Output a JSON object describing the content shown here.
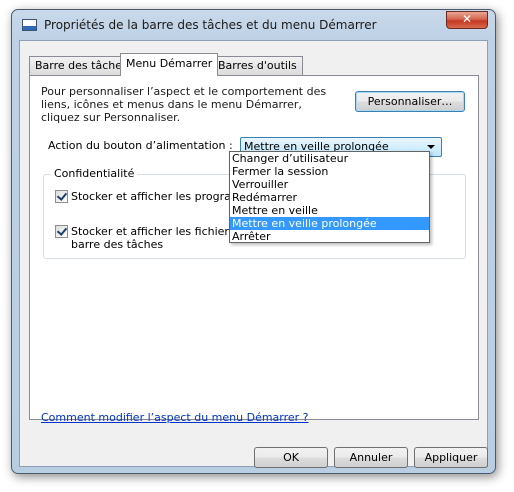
{
  "window": {
    "title": "Propriétés de la barre des tâches et du menu Démarrer",
    "close_glyph": "✕"
  },
  "tabs": [
    {
      "label": "Barre des tâches"
    },
    {
      "label": "Menu Démarrer"
    },
    {
      "label": "Barres d'outils"
    }
  ],
  "start_menu": {
    "intro": "Pour personnaliser l’aspect et le comportement des liens, icônes et menus dans le menu Démarrer, cliquez sur Personnaliser.",
    "customize_button": "Personnaliser…",
    "power_action_label": "Action du bouton d’alimentation :",
    "power_action_value": "Mettre en veille prolongée",
    "power_action_options": [
      "Changer d’utilisateur",
      "Fermer la session",
      "Verrouiller",
      "Redémarrer",
      "Mettre en veille",
      "Mettre en veille prolongée",
      "Arrêter"
    ],
    "privacy_title": "Confidentialité",
    "check_recent_programs": "Stocker et afficher les programmes r",
    "check_recent_files_line1": "Stocker et afficher les fichiers récem",
    "check_recent_files_line2": "barre des tâches",
    "help_link": "Comment modifier l’aspect du menu Démarrer ?"
  },
  "footer": {
    "ok": "OK",
    "cancel": "Annuler",
    "apply": "Appliquer"
  }
}
